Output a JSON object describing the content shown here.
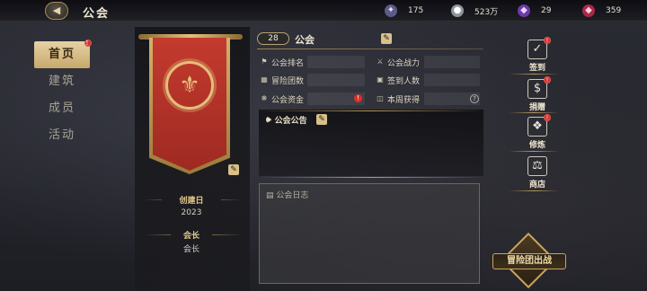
{
  "header": {
    "back_icon": "back-arrow-icon",
    "title": "公会",
    "resources": [
      {
        "name": "crystal",
        "icon": "crystal-icon",
        "value": "175",
        "color": "#b8b2e8"
      },
      {
        "name": "silver",
        "icon": "silver-coin-icon",
        "value": "523万",
        "color": "#d0d4da"
      },
      {
        "name": "gem",
        "icon": "purple-gem-icon",
        "value": "29",
        "color": "#a46be0"
      },
      {
        "name": "ruby",
        "icon": "ruby-icon",
        "value": "359",
        "color": "#e0456a"
      }
    ]
  },
  "sidebar": {
    "items": [
      {
        "label": "首页",
        "active": true,
        "badge": true
      },
      {
        "label": "建筑",
        "active": false
      },
      {
        "label": "成员",
        "active": false
      },
      {
        "label": "活动",
        "active": false
      }
    ]
  },
  "banner": {
    "created_label": "创建日",
    "created_value": "2023",
    "leader_label": "会长",
    "leader_value": "会长"
  },
  "guild": {
    "level": "28",
    "name": "公会",
    "fields": [
      {
        "label": "公会排名",
        "icon": "ranking-icon"
      },
      {
        "label": "公会战力",
        "icon": "crossed-swords-icon"
      },
      {
        "label": "冒险团数",
        "icon": "team-icon"
      },
      {
        "label": "签到人数",
        "icon": "checkin-icon"
      },
      {
        "label": "公会资金",
        "icon": "funds-icon"
      },
      {
        "label": "本周获得",
        "icon": "weekly-icon"
      }
    ],
    "notice_title": "公会公告",
    "log_title": "公会日志"
  },
  "actions": [
    {
      "label": "签到",
      "icon": "calendar-check-icon",
      "badge": true
    },
    {
      "label": "捐赠",
      "icon": "donate-icon",
      "badge": true
    },
    {
      "label": "修炼",
      "icon": "training-icon",
      "badge": true
    },
    {
      "label": "商店",
      "icon": "scales-shop-icon",
      "badge": false
    }
  ],
  "expedition_button": "冒险团出战",
  "colors": {
    "accent_gold": "#d5b06a",
    "banner_red": "#c43a2e",
    "badge_red": "#d9302b"
  }
}
